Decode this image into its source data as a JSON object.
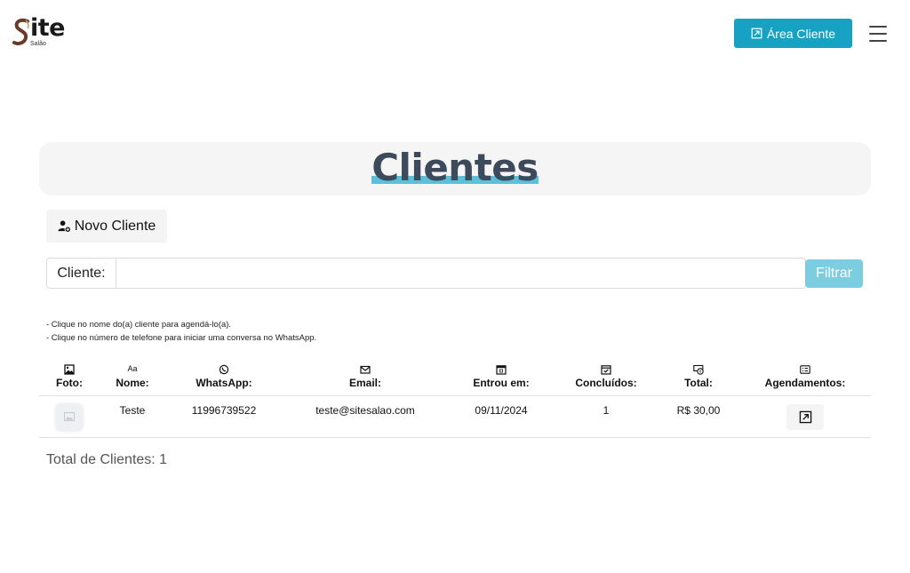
{
  "header": {
    "logo_main": "ite",
    "logo_sub": "Salão",
    "area_button": "Área Cliente",
    "menu_icon": "hamburger-menu-icon"
  },
  "page": {
    "title": "Clientes",
    "new_client_button": "Novo Cliente",
    "filter_label": "Cliente:",
    "filter_value": "",
    "filter_placeholder": "",
    "filter_button": "Filtrar",
    "hints": [
      "- Clique no nome do(a) cliente para agendá-lo(a).",
      "- Clique no número de telefone para iniciar uma conversa no WhatsApp."
    ],
    "total_label": "Total de Clientes: 1"
  },
  "table": {
    "columns": [
      {
        "label": "Foto:",
        "icon": "image-icon"
      },
      {
        "label": "Nome:",
        "icon": "text-aa-icon",
        "icon_text": "Aa"
      },
      {
        "label": "WhatsApp:",
        "icon": "whatsapp-icon"
      },
      {
        "label": "Email:",
        "icon": "envelope-icon"
      },
      {
        "label": "Entrou em:",
        "icon": "calendar-date-icon"
      },
      {
        "label": "Concluídos:",
        "icon": "calendar-check-icon"
      },
      {
        "label": "Total:",
        "icon": "money-icon"
      },
      {
        "label": "Agendamentos:",
        "icon": "list-icon"
      }
    ],
    "rows": [
      {
        "name": "Teste",
        "whatsapp": "11996739522",
        "email": "teste@sitesalao.com",
        "joined": "09/11/2024",
        "completed": "1",
        "total": "R$ 30,00"
      }
    ]
  },
  "colors": {
    "accent": "#17a2c4",
    "filter_button": "#7ccde0",
    "title_text": "#3d4a5c",
    "title_highlight": "#5bc0d8",
    "card_bg": "#f5f5f5"
  }
}
